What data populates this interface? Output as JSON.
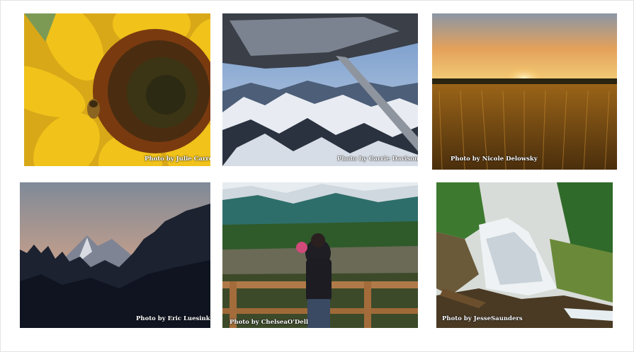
{
  "gallery": {
    "photos": [
      {
        "subject": "sunflower with bee",
        "credit": "Photo by Julie Carrol"
      },
      {
        "subject": "airplane wing over snowy mountains",
        "credit": "Photo by Carrie Davison"
      },
      {
        "subject": "sunset over wheat field",
        "credit": "Photo by Nicole Delowsky"
      },
      {
        "subject": "mountains and forest silhouette at dusk",
        "credit": "Photo by Eric Luesink"
      },
      {
        "subject": "father and child at lake lookout",
        "credit": "Photo by ChelseaO'Dell"
      },
      {
        "subject": "cascading waterfall in forest",
        "credit": "Photo by JesseSaunders"
      }
    ]
  }
}
